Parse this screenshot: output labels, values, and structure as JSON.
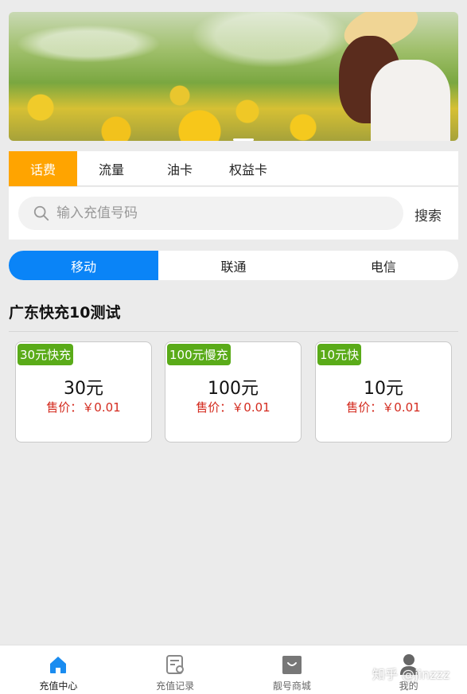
{
  "tabs": [
    {
      "label": "话费",
      "active": true
    },
    {
      "label": "流量",
      "active": false
    },
    {
      "label": "油卡",
      "active": false
    },
    {
      "label": "权益卡",
      "active": false
    }
  ],
  "search": {
    "placeholder": "输入充值号码",
    "button_label": "搜索",
    "icon": "search-icon"
  },
  "carriers": [
    {
      "label": "移动",
      "active": true
    },
    {
      "label": "联通",
      "active": false
    },
    {
      "label": "电信",
      "active": false
    }
  ],
  "section_title": "广东快充10测试",
  "products": [
    {
      "badge": "30元快充",
      "amount": "30元",
      "price": "售价：￥0.01"
    },
    {
      "badge": "100元慢充",
      "amount": "100元",
      "price": "售价：￥0.01"
    },
    {
      "badge": "10元快",
      "amount": "10元",
      "price": "售价：￥0.01"
    }
  ],
  "bottom_nav": [
    {
      "label": "充值中心",
      "icon": "home-icon",
      "active": true
    },
    {
      "label": "充值记录",
      "icon": "record-icon",
      "active": false
    },
    {
      "label": "靓号商城",
      "icon": "shop-icon",
      "active": false
    },
    {
      "label": "我的",
      "icon": "user-icon",
      "active": false
    }
  ],
  "watermark": "知乎 @jinzzz",
  "colors": {
    "tab_active": "#ffa400",
    "carrier_active": "#0a84f7",
    "badge": "#5aab19",
    "price": "#d42b1f",
    "nav_active": "#1a8cf0"
  }
}
